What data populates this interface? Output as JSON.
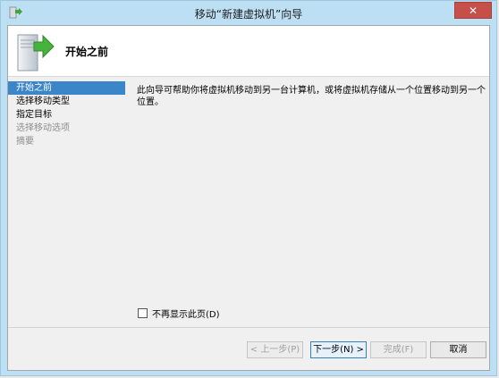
{
  "window": {
    "title": "移动“新建虚拟机”向导",
    "close_label": "✕"
  },
  "header": {
    "title": "开始之前"
  },
  "nav": {
    "items": [
      {
        "label": "开始之前",
        "state": "active"
      },
      {
        "label": "选择移动类型",
        "state": "normal"
      },
      {
        "label": "指定目标",
        "state": "normal"
      },
      {
        "label": "选择移动选项",
        "state": "disabled"
      },
      {
        "label": "摘要",
        "state": "disabled"
      }
    ]
  },
  "main": {
    "description": "此向导可帮助你将虚拟机移动到另一台计算机，或将虚拟机存储从一个位置移动到另一个位置。",
    "dont_show_label": "不再显示此页(D)",
    "dont_show_checked": false
  },
  "buttons": {
    "prev": "< 上一步(P)",
    "next": "下一步(N) >",
    "finish": "完成(F)",
    "cancel": "取消"
  },
  "colors": {
    "titlebar": "#bcdff3",
    "selection": "#3b86c8",
    "close": "#c74f4a"
  }
}
